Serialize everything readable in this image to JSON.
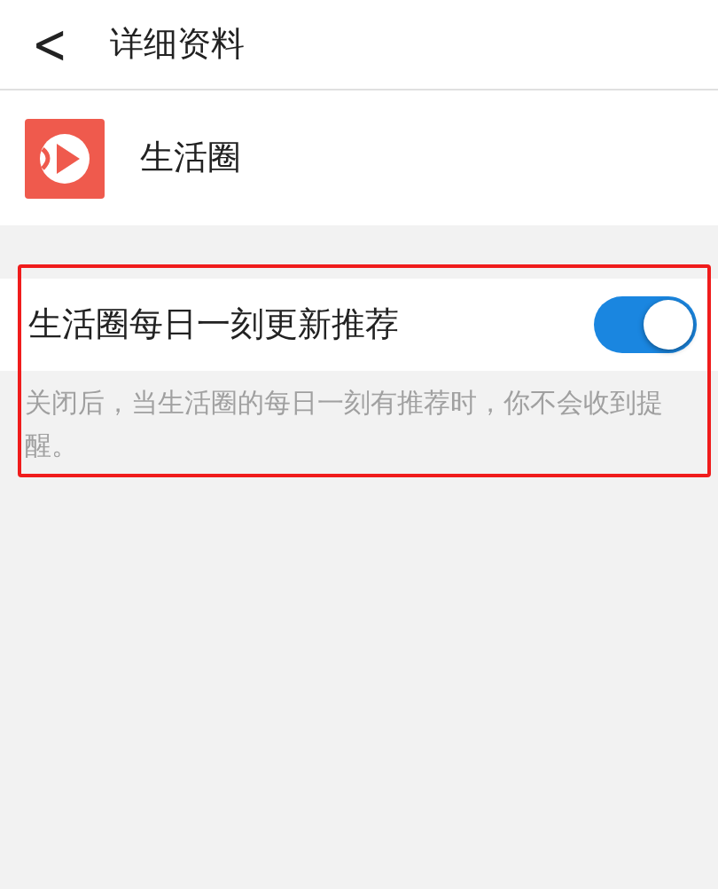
{
  "header": {
    "back": "<",
    "title": "详细资料"
  },
  "app": {
    "name": "生活圈"
  },
  "settings": [
    {
      "kind": "toggle",
      "label": "生活圈每日一刻更新推荐",
      "on": true,
      "highlighted": true,
      "description": "关闭后，当生活圈的每日一刻有推荐时，你不会收到提醒。"
    }
  ]
}
